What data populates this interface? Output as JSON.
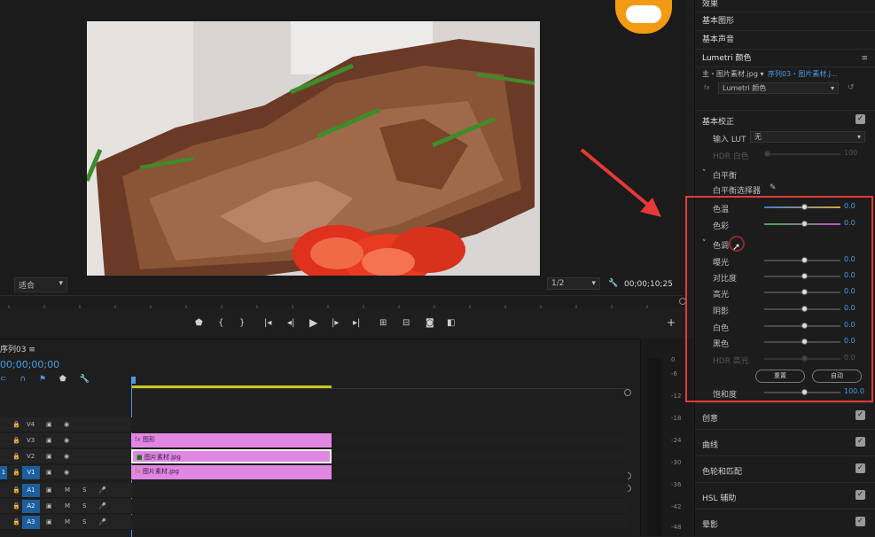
{
  "monitor": {
    "fit_label": "适合",
    "res_label": "1/2",
    "timecode": "00;00;10;25"
  },
  "transport": {
    "buttons": [
      "marker-icon",
      "in-point-icon",
      "out-point-icon",
      "go-to-in-icon",
      "step-back-icon",
      "play-icon",
      "step-forward-icon",
      "go-to-out-icon",
      "insert-icon",
      "overwrite-icon",
      "export-frame-icon",
      "compare-icon",
      "add-button-icon"
    ]
  },
  "timeline": {
    "title": "序列03",
    "timecode": "00;00;00;00",
    "tracks": [
      {
        "name": "V4",
        "type": "video",
        "clip": ""
      },
      {
        "name": "V3",
        "type": "video",
        "clip": "图形"
      },
      {
        "name": "V2",
        "type": "video",
        "clip": "图片素材.jpg"
      },
      {
        "name": "V1",
        "type": "video",
        "clip": "图片素材.jpg",
        "selected": true
      },
      {
        "name": "A1",
        "type": "audio",
        "clip": ""
      },
      {
        "name": "A2",
        "type": "audio",
        "clip": ""
      },
      {
        "name": "A3",
        "type": "audio",
        "clip": ""
      }
    ],
    "meter_ticks": [
      "0",
      "-6",
      "-12",
      "-18",
      "-24",
      "-30",
      "-36",
      "-42",
      "-48"
    ]
  },
  "panel": {
    "top_items": [
      "效果",
      "基本图形",
      "基本声音"
    ],
    "lumetri_title": "Lumetri 颜色",
    "source_master": "主・图片素材.jpg",
    "source_seq": "序列03・图片素材.j...",
    "fx_label": "Lumetri 颜色",
    "basic_correction": "基本校正",
    "input_lut_label": "输入 LUT",
    "input_lut_value": "无",
    "hdr_white_label": "HDR 白色",
    "hdr_white_value": "100",
    "white_balance": "白平衡",
    "wb_selector": "白平衡选择器",
    "temp_label": "色温",
    "temp_value": "0.0",
    "tint_label": "色彩",
    "tint_value": "0.0",
    "tone": "色调",
    "tone_rows": [
      {
        "label": "曝光",
        "value": "0.0"
      },
      {
        "label": "对比度",
        "value": "0.0"
      },
      {
        "label": "高光",
        "value": "0.0"
      },
      {
        "label": "阴影",
        "value": "0.0"
      },
      {
        "label": "白色",
        "value": "0.0"
      },
      {
        "label": "黑色",
        "value": "0.0"
      },
      {
        "label": "HDR 高光",
        "value": "0.0"
      }
    ],
    "reset_label": "重置",
    "auto_label": "自动",
    "saturation_label": "饱和度",
    "saturation_value": "100.0",
    "sections": [
      "创意",
      "曲线",
      "色轮和匹配",
      "HSL 辅助",
      "晕影"
    ]
  },
  "colors": {
    "clip": "#e087e4",
    "accent_blue": "#4a9be0",
    "highlight_red": "#e53935",
    "track_selected": "#1d5e9c"
  }
}
